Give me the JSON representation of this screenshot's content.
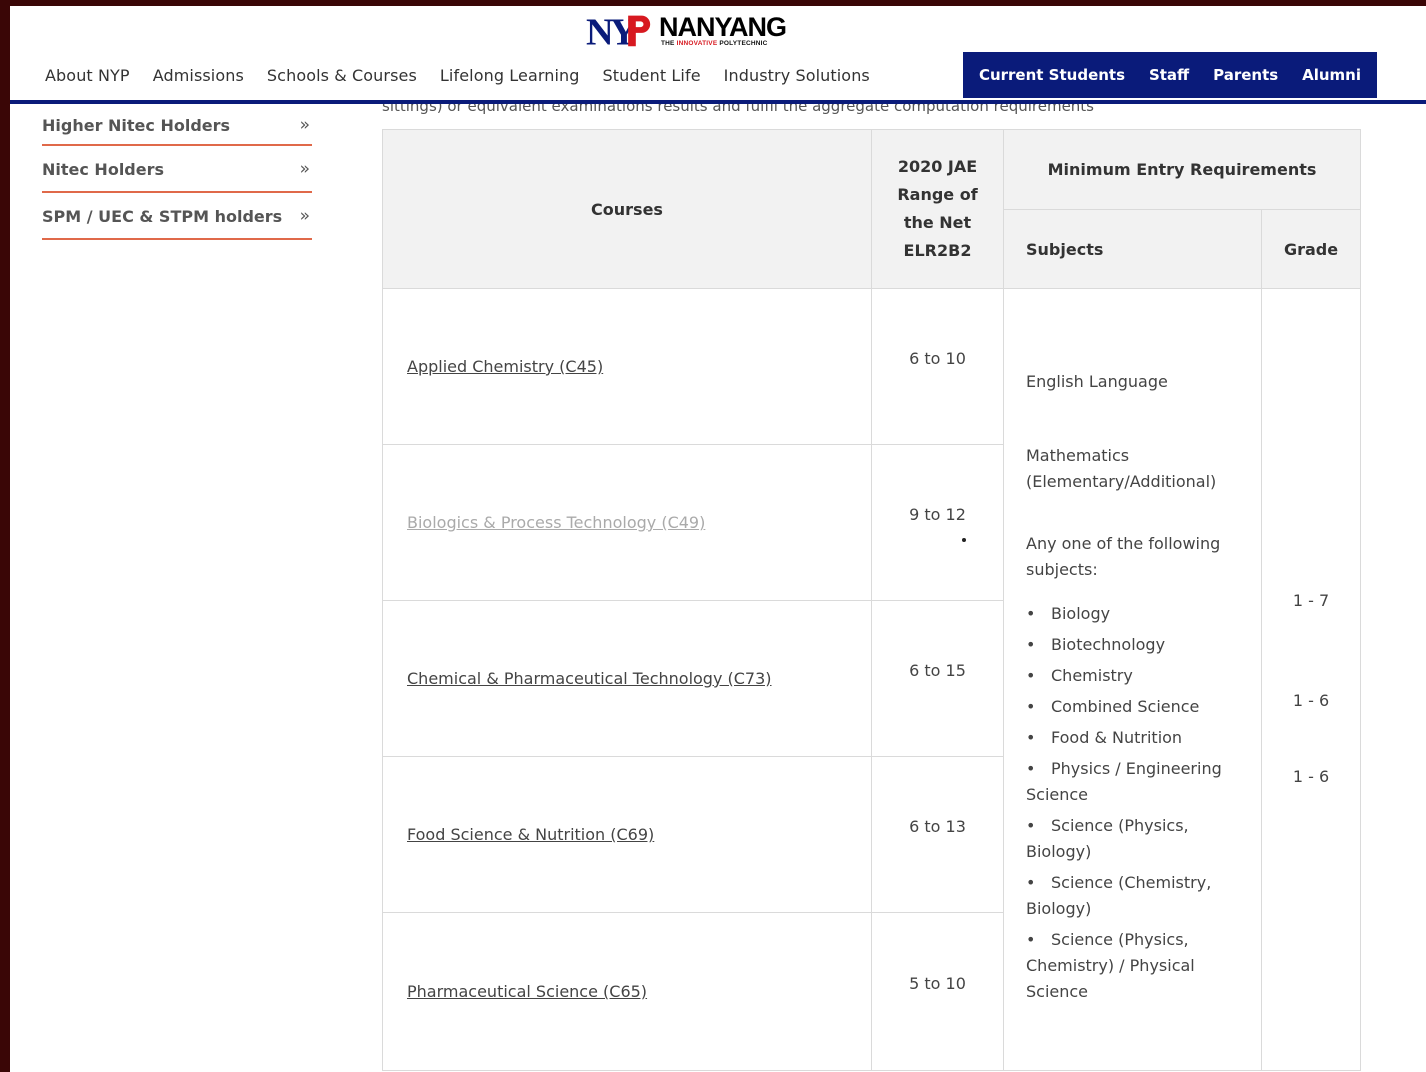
{
  "brand": {
    "name": "NANYANG",
    "tagline_prefix": "THE",
    "tagline_highlight": "INNOVATIVE",
    "tagline_suffix": "POLYTECHNIC",
    "colors": {
      "blue": "#0a1b7a",
      "red": "#d71920",
      "divider": "#e0694a"
    }
  },
  "main_nav": [
    "About NYP",
    "Admissions",
    "Schools & Courses",
    "Lifelong Learning",
    "Student Life",
    "Industry Solutions"
  ],
  "audience_nav": [
    "Current Students",
    "Staff",
    "Parents",
    "Alumni"
  ],
  "intro_partial": "sittings) or equivalent examinations results and fulfil the aggregate computation requirements",
  "sidebar": [
    {
      "label": "Higher Nitec Holders",
      "icon": "double-chevron-right-icon"
    },
    {
      "label": "Nitec Holders",
      "icon": "double-chevron-right-icon"
    },
    {
      "label": "SPM / UEC & STPM holders",
      "icon": "double-chevron-right-icon"
    }
  ],
  "table": {
    "headers": {
      "courses": "Courses",
      "range": "2020 JAE Range of the Net ELR2B2",
      "requirements": "Minimum Entry Requirements",
      "subjects": "Subjects",
      "grade": "Grade"
    },
    "courses": [
      {
        "name": "Applied Chemistry (C45)",
        "range": "6 to 10"
      },
      {
        "name": "Biologics & Process Technology (C49)",
        "range": "9 to 12"
      },
      {
        "name": "Chemical & Pharmaceutical Technology (C73)",
        "range": "6 to 15"
      },
      {
        "name": "Food Science & Nutrition (C69)",
        "range": "6 to 13"
      },
      {
        "name": "Pharmaceutical Science (C65)",
        "range": "5 to 10"
      }
    ],
    "subjects": {
      "english": "English Language",
      "math": "Mathematics (Elementary/Additional)",
      "any_one": "Any one of the following subjects:",
      "list": [
        "Biology",
        "Biotechnology",
        "Chemistry",
        "Combined Science",
        "Food & Nutrition",
        "Physics / Engineering Science",
        "Science (Physics, Biology)",
        "Science (Chemistry, Biology)",
        "Science (Physics, Chemistry) / Physical Science"
      ]
    },
    "grades": [
      "1 - 7",
      "1 - 6",
      "1 - 6"
    ]
  }
}
